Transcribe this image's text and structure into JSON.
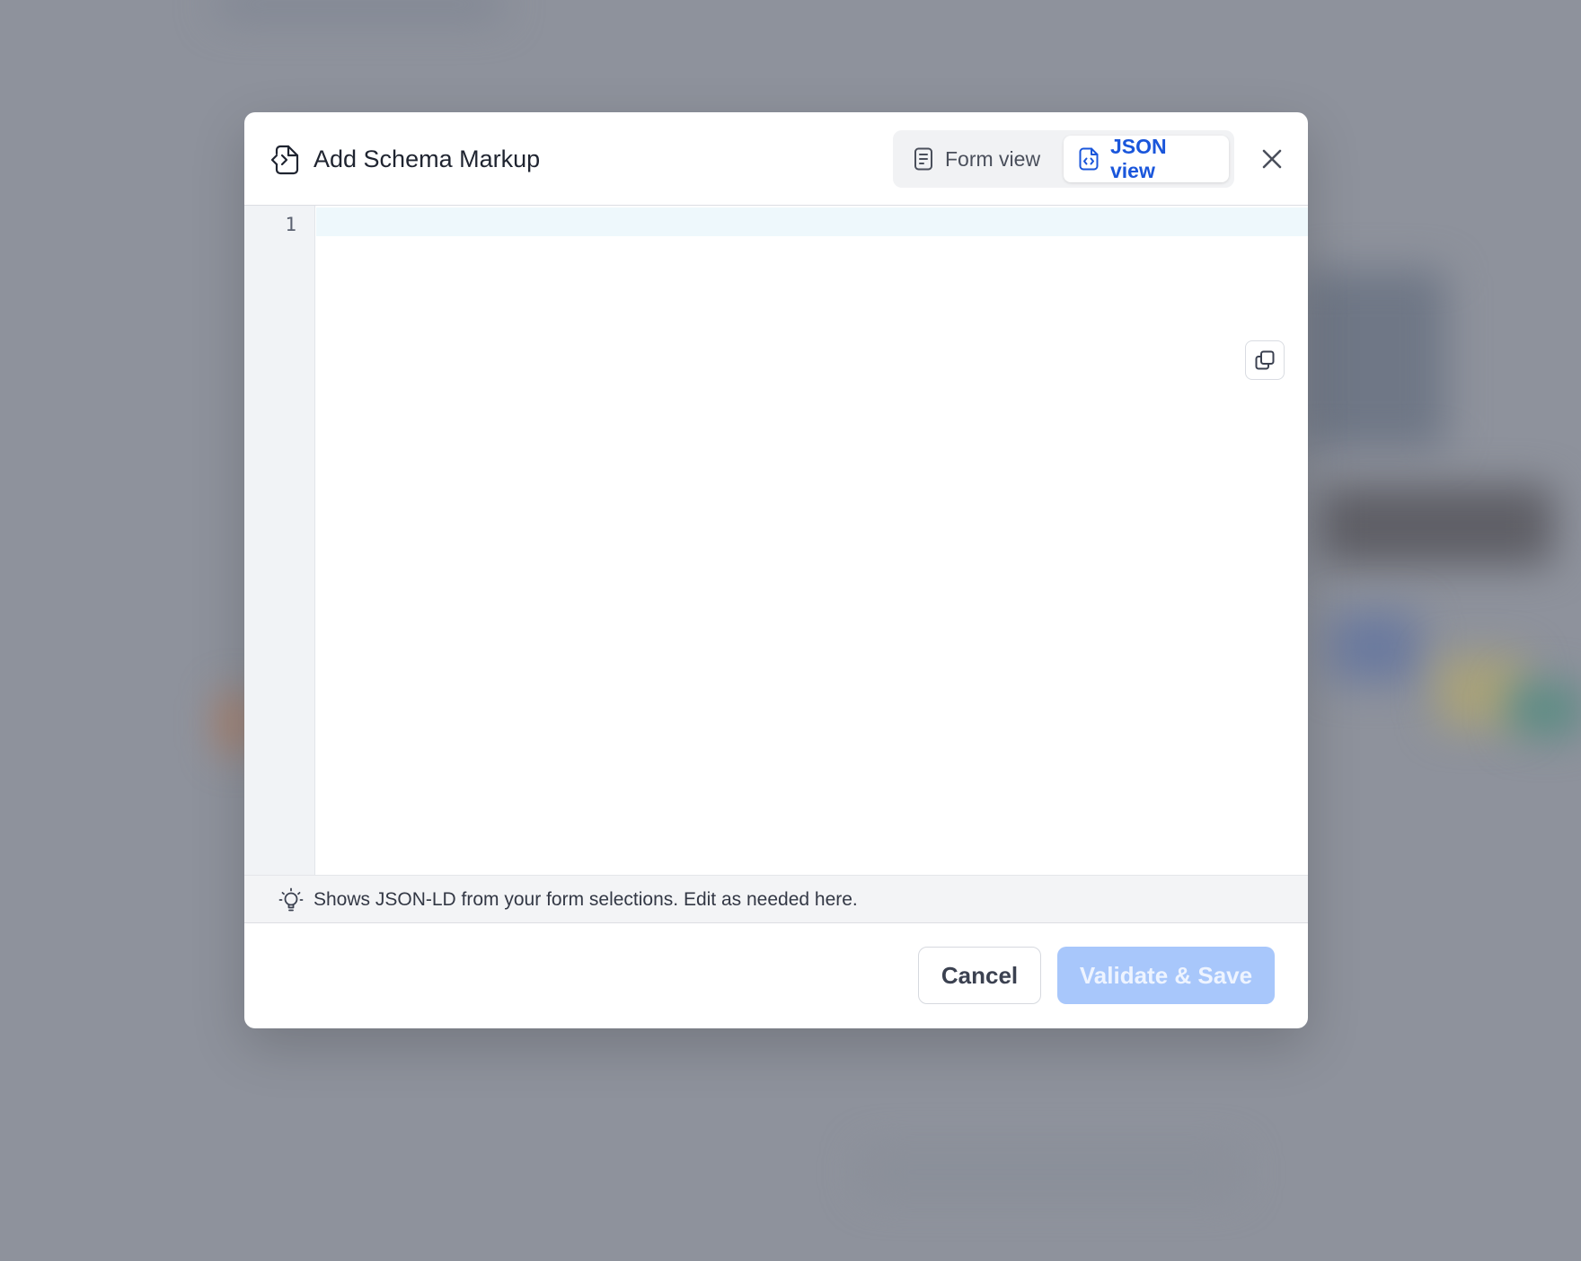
{
  "dialog": {
    "title": "Add Schema Markup",
    "title_icon": "file-code-icon",
    "view_toggle": {
      "form_view_label": "Form view",
      "form_view_icon": "document-lines-icon",
      "json_view_label": "JSON view",
      "json_view_icon": "file-code-icon",
      "selected": "JSON view"
    },
    "close_icon": "close-icon"
  },
  "editor": {
    "line_numbers": [
      "1"
    ],
    "content": "",
    "copy_icon": "copy-icon"
  },
  "hint": {
    "icon": "lightbulb-icon",
    "text": "Shows JSON-LD from your form selections. Edit as needed here."
  },
  "footer": {
    "cancel_label": "Cancel",
    "save_label": "Validate & Save",
    "save_enabled": false
  },
  "colors": {
    "accent": "#1a56db",
    "save_disabled_bg": "#a8c7fb",
    "overlay": "#8e929c"
  }
}
